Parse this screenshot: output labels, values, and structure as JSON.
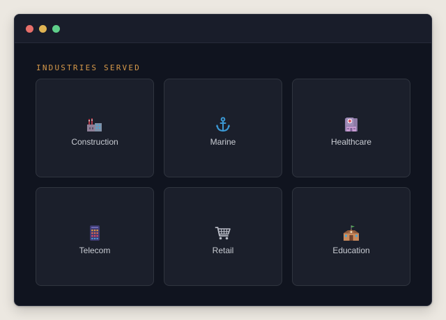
{
  "window": {
    "controls": [
      "close",
      "minimize",
      "maximize"
    ]
  },
  "section": {
    "label": "INDUSTRIES SERVED"
  },
  "industries": [
    {
      "label": "Construction",
      "icon": "factory-icon"
    },
    {
      "label": "Marine",
      "icon": "anchor-icon"
    },
    {
      "label": "Healthcare",
      "icon": "hospital-icon"
    },
    {
      "label": "Telecom",
      "icon": "phone-keypad-icon"
    },
    {
      "label": "Retail",
      "icon": "shopping-cart-icon"
    },
    {
      "label": "Education",
      "icon": "school-icon"
    }
  ],
  "colors": {
    "accent": "#d89a4a",
    "window_bg": "#10141f",
    "card_bg": "#1b1f2b",
    "text": "#c9ccd3"
  }
}
